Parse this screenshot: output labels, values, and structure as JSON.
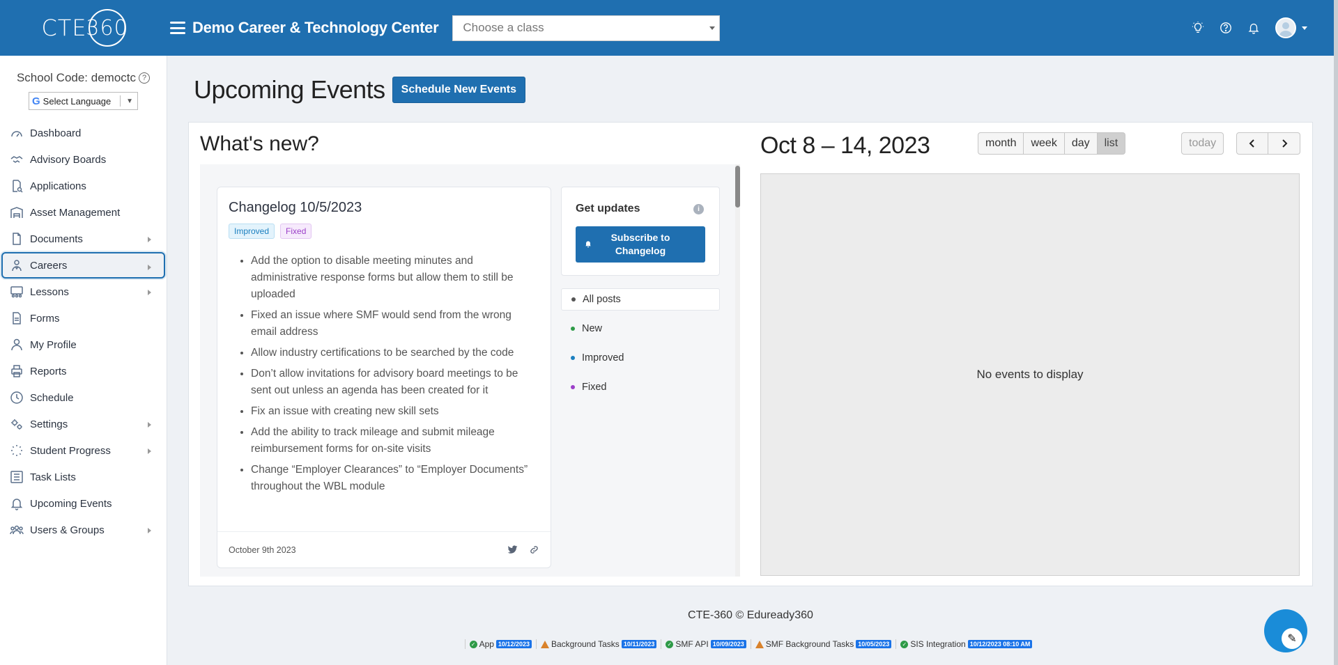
{
  "header": {
    "logo_text": "CTE",
    "logo_ring": "360",
    "school_title": "Demo Career & Technology Center",
    "class_select_placeholder": "Choose a class",
    "icons": [
      "lightbulb-icon",
      "help-icon",
      "bell-icon",
      "avatar"
    ]
  },
  "sidebar": {
    "school_code_label": "School Code: democtc",
    "language_label": "Select Language",
    "items": [
      {
        "label": "Dashboard",
        "icon": "dashboard-icon",
        "has_children": false
      },
      {
        "label": "Advisory Boards",
        "icon": "handshake-icon",
        "has_children": false
      },
      {
        "label": "Applications",
        "icon": "document-search-icon",
        "has_children": false
      },
      {
        "label": "Asset Management",
        "icon": "warehouse-icon",
        "has_children": false
      },
      {
        "label": "Documents",
        "icon": "file-icon",
        "has_children": true
      },
      {
        "label": "Careers",
        "icon": "careers-icon",
        "has_children": true,
        "active": true
      },
      {
        "label": "Lessons",
        "icon": "lessons-icon",
        "has_children": true
      },
      {
        "label": "Forms",
        "icon": "form-icon",
        "has_children": false
      },
      {
        "label": "My Profile",
        "icon": "user-icon",
        "has_children": false
      },
      {
        "label": "Reports",
        "icon": "printer-icon",
        "has_children": false
      },
      {
        "label": "Schedule",
        "icon": "clock-icon",
        "has_children": false
      },
      {
        "label": "Settings",
        "icon": "gears-icon",
        "has_children": true
      },
      {
        "label": "Student Progress",
        "icon": "spinner-icon",
        "has_children": true
      },
      {
        "label": "Task Lists",
        "icon": "list-icon",
        "has_children": false
      },
      {
        "label": "Upcoming Events",
        "icon": "bell-icon",
        "has_children": false
      },
      {
        "label": "Users & Groups",
        "icon": "users-icon",
        "has_children": true
      }
    ]
  },
  "main": {
    "page_title": "Upcoming Events",
    "schedule_button": "Schedule New Events",
    "whats_new": {
      "title": "What's new?",
      "changelog": {
        "title": "Changelog 10/5/2023",
        "tags": [
          "Improved",
          "Fixed"
        ],
        "items": [
          "Add the option to disable meeting minutes and administrative response forms but allow them to still be uploaded",
          "Fixed an issue where SMF would send from the wrong email address",
          "Allow industry certifications to be searched by the code",
          "Don’t allow invitations for advisory board meetings to be sent out unless an agenda has been created for it",
          "Fix an issue with creating new skill sets",
          "Add the ability to track mileage and submit mileage reimbursement forms for on-site visits",
          "Change “Employer Clearances” to “Employer Documents” throughout the WBL module"
        ],
        "date": "October 9th 2023"
      },
      "updates": {
        "title": "Get updates",
        "subscribe_line1": "Subscribe to",
        "subscribe_line2": "Changelog"
      },
      "filters": [
        {
          "label": "All posts",
          "color": "#555555",
          "selected": true
        },
        {
          "label": "New",
          "color": "#2e9a47",
          "selected": false
        },
        {
          "label": "Improved",
          "color": "#1b7fbf",
          "selected": false
        },
        {
          "label": "Fixed",
          "color": "#9b3fc8",
          "selected": false
        }
      ]
    },
    "calendar": {
      "range_title": "Oct 8 – 14, 2023",
      "views": [
        "month",
        "week",
        "day",
        "list"
      ],
      "active_view": "list",
      "today_label": "today",
      "prev_icon": "chevron-left-icon",
      "next_icon": "chevron-right-icon",
      "empty_text": "No events to display"
    }
  },
  "footer": {
    "copyright": "CTE-360 © Eduready360",
    "statuses": [
      {
        "label": "App",
        "state": "ok",
        "date": "10/12/2023"
      },
      {
        "label": "Background Tasks",
        "state": "warn",
        "date": "10/11/2023"
      },
      {
        "label": "SMF API",
        "state": "ok",
        "date": "10/09/2023"
      },
      {
        "label": "SMF Background Tasks",
        "state": "warn",
        "date": "10/05/2023"
      },
      {
        "label": "SIS Integration",
        "state": "ok",
        "date": "10/12/2023 08:10 AM"
      }
    ]
  },
  "colors": {
    "brand": "#1f6fb0",
    "ok": "#2e9a47",
    "warn": "#d9822b"
  }
}
